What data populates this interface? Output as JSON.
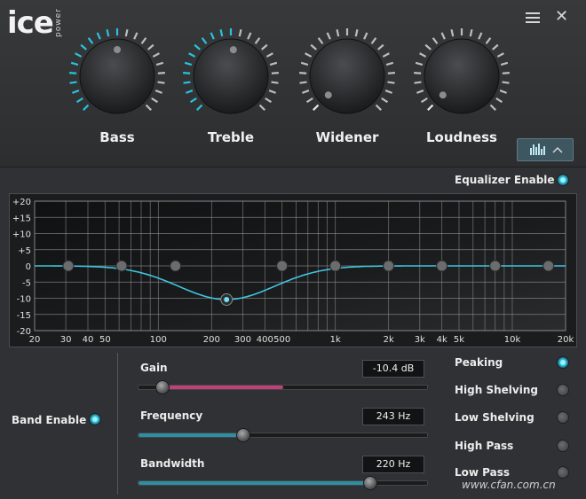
{
  "app": {
    "logo_text": "ice",
    "logo_sub": "power"
  },
  "header": {
    "menu_icon": "hamburger-menu-icon",
    "close_icon": "close-icon"
  },
  "knobs": [
    {
      "label": "Bass",
      "level": 0.5
    },
    {
      "label": "Treble",
      "level": 0.52
    },
    {
      "label": "Widener",
      "level": 0.0
    },
    {
      "label": "Loudness",
      "level": 0.0
    }
  ],
  "view_toggle": {
    "icon": "equalizer-bars-icon",
    "chevron": "chevron-up-icon"
  },
  "equalizer": {
    "enable_label": "Equalizer Enable",
    "enabled": true,
    "y_ticks": [
      "+20",
      "+15",
      "+10",
      "+5",
      "0",
      "-5",
      "-10",
      "-15",
      "-20"
    ],
    "x_ticks": [
      {
        "label": "20",
        "hz": 20
      },
      {
        "label": "30",
        "hz": 30
      },
      {
        "label": "40",
        "hz": 40
      },
      {
        "label": "50",
        "hz": 50
      },
      {
        "label": "100",
        "hz": 100
      },
      {
        "label": "200",
        "hz": 200
      },
      {
        "label": "300",
        "hz": 300
      },
      {
        "label": "400",
        "hz": 400
      },
      {
        "label": "500",
        "hz": 500
      },
      {
        "label": "1k",
        "hz": 1000
      },
      {
        "label": "2k",
        "hz": 2000
      },
      {
        "label": "3k",
        "hz": 3000
      },
      {
        "label": "4k",
        "hz": 4000
      },
      {
        "label": "5k",
        "hz": 5000
      },
      {
        "label": "10k",
        "hz": 10000
      },
      {
        "label": "20k",
        "hz": 20000
      }
    ],
    "y_range": [
      -20,
      20
    ],
    "x_range_hz": [
      20,
      20000
    ],
    "nodes": [
      {
        "hz": 31,
        "gain": 0
      },
      {
        "hz": 62,
        "gain": 0
      },
      {
        "hz": 125,
        "gain": 0
      },
      {
        "hz": 243,
        "gain": -10.4,
        "selected": true
      },
      {
        "hz": 500,
        "gain": 0
      },
      {
        "hz": 1000,
        "gain": 0
      },
      {
        "hz": 2000,
        "gain": 0
      },
      {
        "hz": 4000,
        "gain": 0
      },
      {
        "hz": 8000,
        "gain": 0
      },
      {
        "hz": 16000,
        "gain": 0
      }
    ]
  },
  "band": {
    "enable_label": "Band Enable",
    "enabled": true,
    "gain": {
      "label": "Gain",
      "value": "-10.4 dB",
      "level": 0.08
    },
    "frequency": {
      "label": "Frequency",
      "value": "243 Hz",
      "level": 0.36
    },
    "bandwidth": {
      "label": "Bandwidth",
      "value": "220 Hz",
      "level": 0.8
    }
  },
  "filter_types": [
    {
      "label": "Peaking",
      "selected": true
    },
    {
      "label": "High Shelving",
      "selected": false
    },
    {
      "label": "Low Shelving",
      "selected": false
    },
    {
      "label": "High Pass",
      "selected": false
    },
    {
      "label": "Low Pass",
      "selected": false
    }
  ],
  "watermark": "www.cfan.com.cn",
  "colors": {
    "accent": "#27c3e0",
    "gain_fill": "#c0407a",
    "curve": "#40c4e0"
  }
}
